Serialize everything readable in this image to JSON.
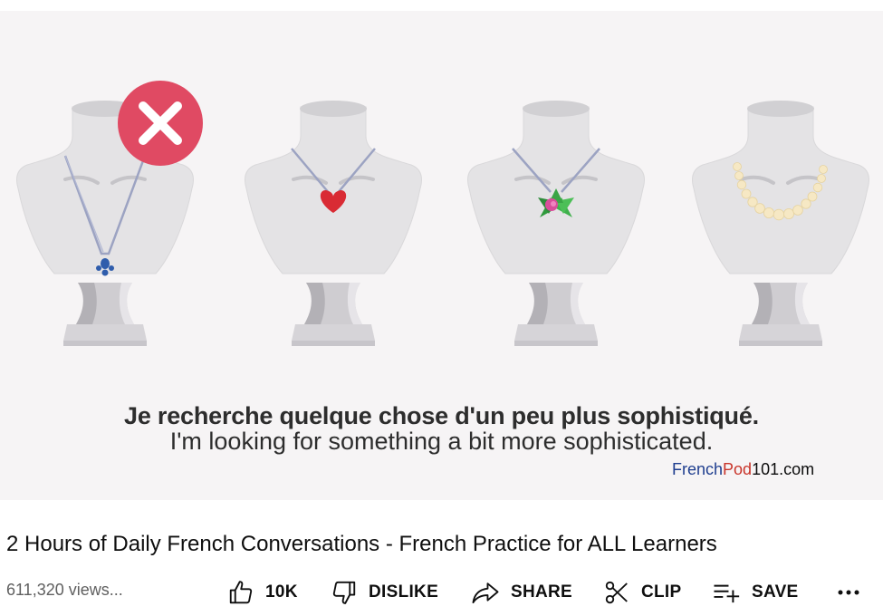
{
  "video": {
    "caption_french": "Je recherche quelque chose d'un peu plus sophistiqué.",
    "caption_english": "I'm looking for something a bit more sophisticated.",
    "brand": {
      "part1": "French",
      "part2": "Pod",
      "part3": "101.com"
    },
    "colors": {
      "background": "#f6f4f5",
      "bust": "#e4e3e5",
      "reject": "#e04a63"
    }
  },
  "title": "2 Hours of Daily French Conversations - French Practice for ALL Learners",
  "views": "611,320 views...",
  "actions": {
    "like": {
      "label": "10K",
      "icon": "thumbs-up-icon"
    },
    "dislike": {
      "label": "DISLIKE",
      "icon": "thumbs-down-icon"
    },
    "share": {
      "label": "SHARE",
      "icon": "share-arrow-icon"
    },
    "clip": {
      "label": "CLIP",
      "icon": "scissors-icon"
    },
    "save": {
      "label": "SAVE",
      "icon": "playlist-add-icon"
    },
    "more": {
      "icon": "more-horizontal-icon"
    }
  }
}
